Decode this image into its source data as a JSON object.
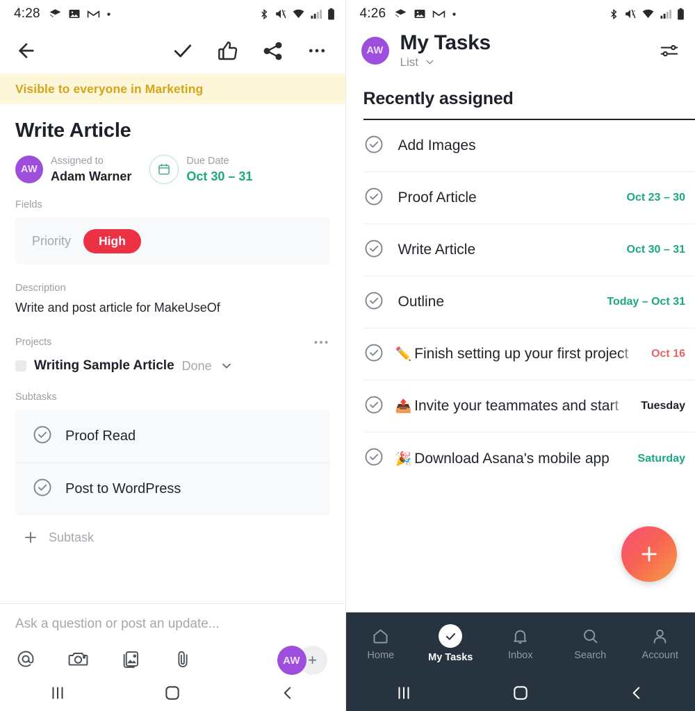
{
  "left": {
    "statusbar": {
      "time": "4:28",
      "icons_left": [
        "layers-icon",
        "image-icon",
        "gmail-icon",
        "dot-icon"
      ],
      "icons_right": [
        "bluetooth-icon",
        "mute-icon",
        "wifi-icon",
        "signal-icon",
        "battery-icon"
      ]
    },
    "toolbar": {
      "back": "back-arrow-icon",
      "complete": "check-icon",
      "like": "thumbs-up-icon",
      "share": "share-icon",
      "more": "more-options-icon"
    },
    "banner": {
      "text": "Visible to everyone in Marketing"
    },
    "task": {
      "title": "Write Article",
      "assignee_label": "Assigned to",
      "assignee_name": "Adam Warner",
      "assignee_initials": "AW",
      "due_label": "Due Date",
      "due_value": "Oct 30 – 31"
    },
    "fields": {
      "heading": "Fields",
      "name": "Priority",
      "value": "High"
    },
    "description": {
      "heading": "Description",
      "text": "Write and post article for MakeUseOf"
    },
    "projects": {
      "heading": "Projects",
      "name": "Writing Sample Article",
      "status": "Done"
    },
    "subtasks": {
      "heading": "Subtasks",
      "items": [
        {
          "label": "Proof Read"
        },
        {
          "label": "Post to WordPress"
        }
      ],
      "add_label": "Subtask"
    },
    "composer": {
      "placeholder": "Ask a question or post an update...",
      "icons": [
        "mention-icon",
        "camera-icon",
        "photo-library-icon",
        "attachment-icon"
      ],
      "avatar_initials": "AW",
      "add_collaborator": "+"
    },
    "navbar": [
      "recents-icon",
      "home-icon",
      "back-icon"
    ]
  },
  "right": {
    "statusbar": {
      "time": "4:26",
      "icons_left": [
        "layers-icon",
        "image-icon",
        "gmail-icon",
        "dot-icon"
      ],
      "icons_right": [
        "bluetooth-icon",
        "mute-icon",
        "wifi-icon",
        "signal-icon",
        "battery-icon"
      ]
    },
    "header": {
      "avatar_initials": "AW",
      "title": "My Tasks",
      "view": "List",
      "filter_icon": "filter-settings-icon"
    },
    "section": {
      "title": "Recently assigned"
    },
    "tasks": [
      {
        "emoji": "",
        "label": "Add Images",
        "date": "",
        "date_style": "teal"
      },
      {
        "emoji": "",
        "label": "Proof Article",
        "date": "Oct 23 – 30",
        "date_style": "teal"
      },
      {
        "emoji": "",
        "label": "Write Article",
        "date": "Oct 30 – 31",
        "date_style": "teal"
      },
      {
        "emoji": "",
        "label": "Outline",
        "date": "Today – Oct 31",
        "date_style": "teal"
      },
      {
        "emoji": "✏️",
        "label": "Finish setting up your first project",
        "date": "Oct 16",
        "date_style": "overdue"
      },
      {
        "emoji": "📤",
        "label": "Invite your teammates and start collaborating",
        "date": "Tuesday",
        "date_style": "plain"
      },
      {
        "emoji": "🎉",
        "label": "Download Asana's mobile app",
        "date": "Saturday",
        "date_style": "teal"
      }
    ],
    "fab": {
      "label": "+",
      "icon": "add-task-icon"
    },
    "tabbar": [
      {
        "label": "Home",
        "icon": "home-icon",
        "active": false
      },
      {
        "label": "My Tasks",
        "icon": "check-icon",
        "active": true
      },
      {
        "label": "Inbox",
        "icon": "bell-icon",
        "active": false
      },
      {
        "label": "Search",
        "icon": "search-icon",
        "active": false
      },
      {
        "label": "Account",
        "icon": "person-icon",
        "active": false
      }
    ],
    "navbar": [
      "recents-icon",
      "home-icon",
      "back-icon"
    ]
  },
  "colors": {
    "banner_bg": "#fdf6d8",
    "banner_text": "#d3a51b",
    "accent_teal": "#1aa882",
    "priority_high": "#ec3145",
    "avatar_purple": "#9d4edd",
    "overdue_red": "#e4646a",
    "tabbar_bg": "#27333f",
    "fab_gradient_start": "#f9546f",
    "fab_gradient_end": "#f79645"
  }
}
